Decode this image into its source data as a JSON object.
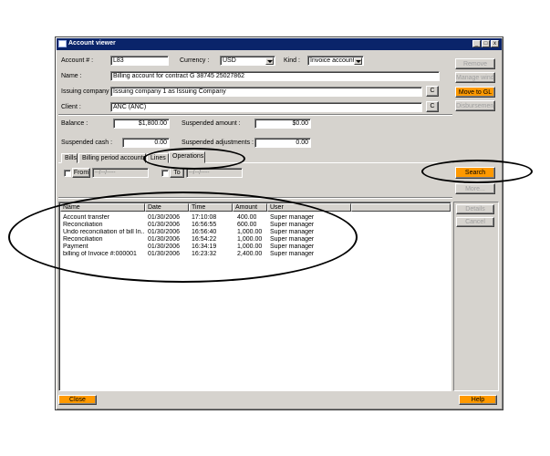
{
  "window": {
    "title": "Account viewer"
  },
  "account": {
    "account_label": "Account # :",
    "account_value": "L83",
    "currency_label": "Currency :",
    "currency_value": "USD",
    "kind_label": "Kind :",
    "kind_value": "Invoice account",
    "name_label": "Name :",
    "name_value": "Billing account for contract G 38745 25027862",
    "issuing_label": "Issuing company :",
    "issuing_value": "Issuing company 1 as Issuing Company",
    "client_label": "Client :",
    "client_value": "ANC (ANC)",
    "c_button": "C"
  },
  "right_buttons": {
    "remove": "Remove",
    "manage_window": "Manage window",
    "move_to_gl": "Move to GL",
    "disbursement": "Disbursement"
  },
  "balances": {
    "balance_label": "Balance :",
    "balance_value": "$1,800.00",
    "suspended_amount_label": "Suspended amount :",
    "suspended_amount_value": "$0.00",
    "suspended_cash_label": "Suspended cash :",
    "suspended_cash_value": "0.00",
    "suspended_adj_label": "Suspended adjustments :",
    "suspended_adj_value": "0.00"
  },
  "tabs": [
    "Bills",
    "Billing period accounts",
    "Lines",
    "Operations"
  ],
  "filter": {
    "from_label": "From",
    "from_value": "--/--/----",
    "to_label": "To",
    "to_value": "--/--/----",
    "search": "Search",
    "more": "More..."
  },
  "grid": {
    "columns": [
      "Name",
      "Date",
      "Time",
      "Amount",
      "User"
    ],
    "rows": [
      [
        "Account transfer",
        "01/30/2006",
        "17:10:08",
        "400.00",
        "Super manager"
      ],
      [
        "Reconciliation",
        "01/30/2006",
        "16:56:55",
        "600.00",
        "Super manager"
      ],
      [
        "Undo reconciliation of bill In...",
        "01/30/2006",
        "16:56:40",
        "1,000.00",
        "Super manager"
      ],
      [
        "Reconciliation",
        "01/30/2006",
        "16:54:22",
        "1,000.00",
        "Super manager"
      ],
      [
        "Payment",
        "01/30/2006",
        "16:34:19",
        "1,000.00",
        "Super manager"
      ],
      [
        "billing of Invoice #:000001",
        "01/30/2006",
        "16:23:32",
        "2,400.00",
        "Super manager"
      ]
    ]
  },
  "grid_side_buttons": {
    "details": "Details",
    "cancel": "Cancel"
  },
  "footer": {
    "close": "Close",
    "help": "Help"
  },
  "colors": {
    "titlebar": "#0a246a",
    "window_bg": "#d6d3ce",
    "accent_button": "#ff9900"
  }
}
